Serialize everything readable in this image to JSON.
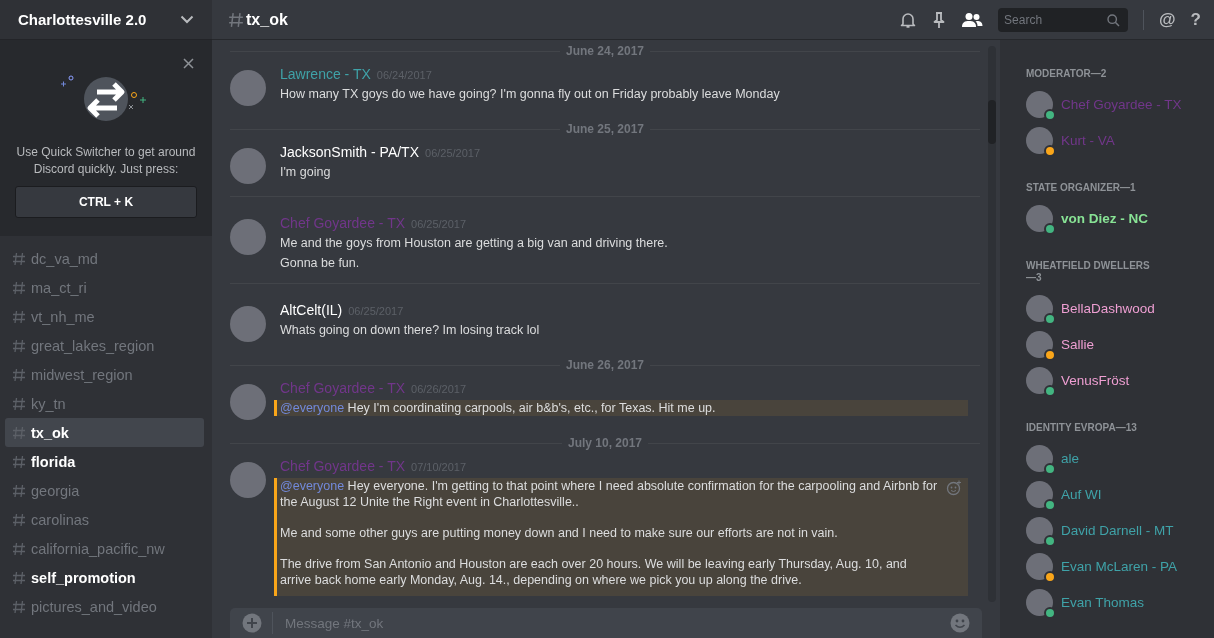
{
  "server": {
    "name": "Charlottesville 2.0"
  },
  "quick_switcher": {
    "text": "Use Quick Switcher to get around Discord quickly. Just press:",
    "shortcut": "CTRL + K"
  },
  "channels": [
    {
      "name": "dc_va_md",
      "selected": false,
      "unread": false
    },
    {
      "name": "ma_ct_ri",
      "selected": false,
      "unread": false
    },
    {
      "name": "vt_nh_me",
      "selected": false,
      "unread": false
    },
    {
      "name": "great_lakes_region",
      "selected": false,
      "unread": false
    },
    {
      "name": "midwest_region",
      "selected": false,
      "unread": false
    },
    {
      "name": "ky_tn",
      "selected": false,
      "unread": false
    },
    {
      "name": "tx_ok",
      "selected": true,
      "unread": true
    },
    {
      "name": "florida",
      "selected": false,
      "unread": true
    },
    {
      "name": "georgia",
      "selected": false,
      "unread": false
    },
    {
      "name": "carolinas",
      "selected": false,
      "unread": false
    },
    {
      "name": "california_pacific_nw",
      "selected": false,
      "unread": false
    },
    {
      "name": "self_promotion",
      "selected": false,
      "unread": true
    },
    {
      "name": "pictures_and_video",
      "selected": false,
      "unread": false
    }
  ],
  "channel_header": {
    "name": "tx_ok"
  },
  "toolbar": {
    "search_placeholder": "Search",
    "mentions": "@",
    "help": "?"
  },
  "messages": [
    {
      "kind": "date",
      "text": "June 24, 2017"
    },
    {
      "kind": "message",
      "author": "Lawrence - TX",
      "color": "#3fa2a8",
      "time": "06/24/2017",
      "highlighted": false,
      "spaced": false,
      "lines": [
        "How many TX goys do we have going? I'm gonna fly out on Friday probably leave Monday"
      ]
    },
    {
      "kind": "date",
      "text": "June 25, 2017"
    },
    {
      "kind": "message",
      "author": "JacksonSmith - PA/TX",
      "color": "#ffffff",
      "time": "06/25/2017",
      "highlighted": false,
      "spaced": false,
      "lines": [
        "I'm going"
      ]
    },
    {
      "kind": "message",
      "author": "Chef Goyardee - TX",
      "color": "#71368a",
      "time": "06/25/2017",
      "highlighted": false,
      "spaced": false,
      "lines": [
        "Me and the goys from Houston are getting a big van and driving there.",
        "Gonna be fun."
      ]
    },
    {
      "kind": "message",
      "author": "AltCelt(IL)",
      "color": "#ffffff",
      "time": "06/25/2017",
      "highlighted": false,
      "spaced": false,
      "lines": [
        "Whats going on down there? Im losing track lol"
      ]
    },
    {
      "kind": "date",
      "text": "June 26, 2017"
    },
    {
      "kind": "message",
      "author": "Chef Goyardee - TX",
      "color": "#71368a",
      "time": "06/26/2017",
      "highlighted": true,
      "spaced": false,
      "mention": "@everyone",
      "lines": [
        "Hey I'm coordinating carpools, air b&b's, etc., for Texas. Hit me up."
      ]
    },
    {
      "kind": "date",
      "text": "July 10, 2017"
    },
    {
      "kind": "message",
      "author": "Chef Goyardee - TX",
      "color": "#71368a",
      "time": "07/10/2017",
      "highlighted": true,
      "spaced": true,
      "mention": "@everyone",
      "lines": [
        "Hey everyone. I'm getting to that point where I need absolute confirmation for the carpooling and Airbnb for the August 12 Unite the Right event in Charlottesville..",
        "Me and some other guys are putting money down and I need to make sure our efforts are not in vain.",
        "The drive from San Antonio and Houston are each over 20 hours. We will be leaving early Thursday, Aug. 10, and arrive back home early Monday, Aug. 14., depending on where we pick you up along the drive."
      ]
    }
  ],
  "composer": {
    "placeholder": "Message #tx_ok"
  },
  "member_groups": [
    {
      "title": "MODERATOR—2",
      "members": [
        {
          "name": "Chef Goyardee - TX",
          "color": "#71368a",
          "status": {
            "color": "#43b581"
          }
        },
        {
          "name": "Kurt - VA",
          "color": "#71368a",
          "status": {
            "color": "#faa61a"
          }
        }
      ]
    },
    {
      "title": "STATE ORGANIZER—1",
      "members": [
        {
          "name": "von Diez - NC",
          "color": "#88e395",
          "status": {
            "color": "#43b581"
          }
        }
      ]
    },
    {
      "title": "WHEATFIELD DWELLERS—3",
      "members": [
        {
          "name": "BellaDashwood",
          "color": "#ef9fd3",
          "status": {
            "color": "#43b581"
          }
        },
        {
          "name": "Sallie",
          "color": "#ef9fd3",
          "status": {
            "color": "#faa61a"
          }
        },
        {
          "name": "VenusFröst",
          "color": "#ef9fd3",
          "status": {
            "color": "#43b581"
          }
        }
      ]
    },
    {
      "title": "IDENTITY EVROPA—13",
      "members": [
        {
          "name": "ale",
          "color": "#3fa2a8",
          "status": {
            "color": "#43b581"
          }
        },
        {
          "name": "Auf WI",
          "color": "#3fa2a8",
          "status": {
            "color": "#43b581"
          }
        },
        {
          "name": "David Darnell - MT",
          "color": "#3fa2a8",
          "status": {
            "color": "#43b581"
          }
        },
        {
          "name": "Evan McLaren - PA",
          "color": "#3fa2a8",
          "status": {
            "color": "#faa61a"
          }
        },
        {
          "name": "Evan Thomas",
          "color": "#3fa2a8",
          "status": {
            "color": "#43b581"
          }
        }
      ]
    }
  ]
}
